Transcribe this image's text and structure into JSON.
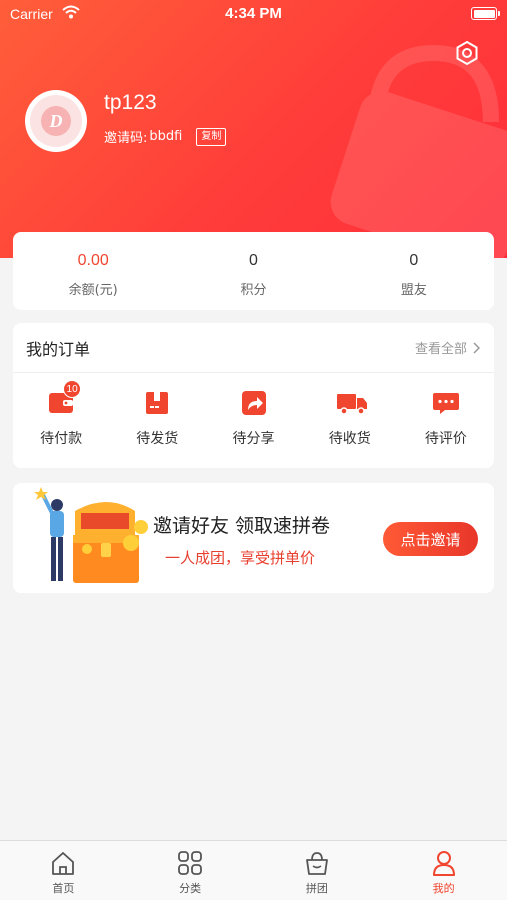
{
  "status_bar": {
    "carrier": "Carrier",
    "time": "4:34 PM"
  },
  "profile": {
    "username": "tp123",
    "invite_label": "邀请码:",
    "invite_code": "bbdfi",
    "copy_label": "复制"
  },
  "stats": [
    {
      "value": "0.00",
      "label": "余额(元)"
    },
    {
      "value": "0",
      "label": "积分"
    },
    {
      "value": "0",
      "label": "盟友"
    }
  ],
  "orders": {
    "title": "我的订单",
    "view_all": "查看全部",
    "items": [
      {
        "label": "待付款",
        "icon": "wallet-icon",
        "badge": "10"
      },
      {
        "label": "待发货",
        "icon": "package-icon"
      },
      {
        "label": "待分享",
        "icon": "share-icon"
      },
      {
        "label": "待收货",
        "icon": "truck-icon"
      },
      {
        "label": "待评价",
        "icon": "comment-icon"
      }
    ]
  },
  "invite_banner": {
    "title": "邀请好友 领取速拼卷",
    "subtitle": "一人成团，享受拼单价",
    "button": "点击邀请"
  },
  "tabbar": [
    {
      "label": "首页",
      "icon": "home-icon"
    },
    {
      "label": "分类",
      "icon": "grid-icon"
    },
    {
      "label": "拼团",
      "icon": "basket-icon"
    },
    {
      "label": "我的",
      "icon": "user-icon",
      "active": true
    }
  ],
  "colors": {
    "accent": "#f0462f",
    "header_start": "#ff5e3a",
    "header_end": "#ff2d3a"
  }
}
